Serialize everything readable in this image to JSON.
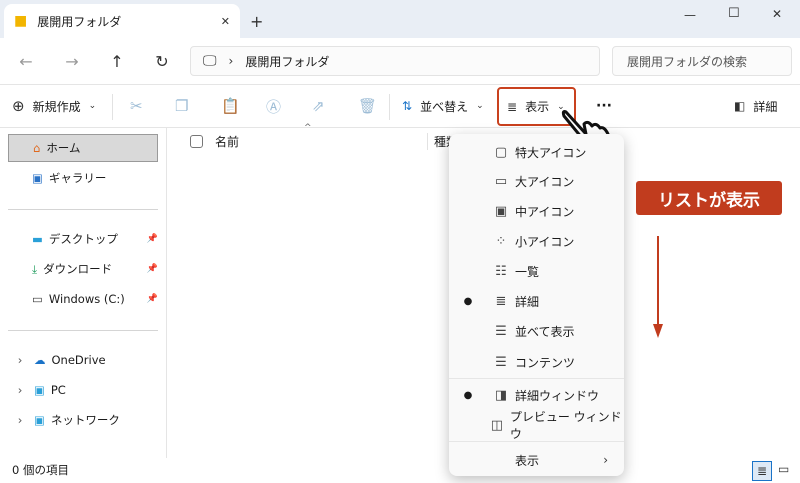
{
  "window": {
    "tab_title": "展開用フォルダ",
    "new_tab": "+",
    "minimize": "—",
    "maximize": "☐",
    "close": "✕"
  },
  "address": {
    "path": "展開用フォルダ",
    "search_placeholder": "展開用フォルダの検索"
  },
  "toolbar": {
    "new": "新規作成",
    "sort": "並べ替え",
    "view": "表示",
    "more": "···",
    "details": "詳細"
  },
  "sidebar": {
    "items": [
      {
        "label": "ホーム"
      },
      {
        "label": "ギャラリー"
      },
      {
        "label": "デスクトップ"
      },
      {
        "label": "ダウンロード"
      },
      {
        "label": "Windows (C:)"
      },
      {
        "label": "OneDrive"
      },
      {
        "label": "PC"
      },
      {
        "label": "ネットワーク"
      }
    ]
  },
  "columns": {
    "name": "名前",
    "type": "種類"
  },
  "view_menu": {
    "items": [
      {
        "label": "特大アイコン",
        "icon": "extra-large-icons",
        "selected": false
      },
      {
        "label": "大アイコン",
        "icon": "large-icons",
        "selected": false
      },
      {
        "label": "中アイコン",
        "icon": "medium-icons",
        "selected": false
      },
      {
        "label": "小アイコン",
        "icon": "small-icons",
        "selected": false
      },
      {
        "label": "一覧",
        "icon": "list",
        "selected": false
      },
      {
        "label": "詳細",
        "icon": "details",
        "selected": true
      },
      {
        "label": "並べて表示",
        "icon": "tiles",
        "selected": false
      },
      {
        "label": "コンテンツ",
        "icon": "content",
        "selected": false
      },
      {
        "label": "詳細ウィンドウ",
        "icon": "details-pane",
        "selected": true
      },
      {
        "label": "プレビュー ウィンドウ",
        "icon": "preview-pane",
        "selected": false
      },
      {
        "label": "表示",
        "icon": "",
        "selected": false
      }
    ]
  },
  "annotation": {
    "text": "リストが表示",
    "color": "#c13c1e"
  },
  "status": {
    "items": "0 個の項目"
  }
}
